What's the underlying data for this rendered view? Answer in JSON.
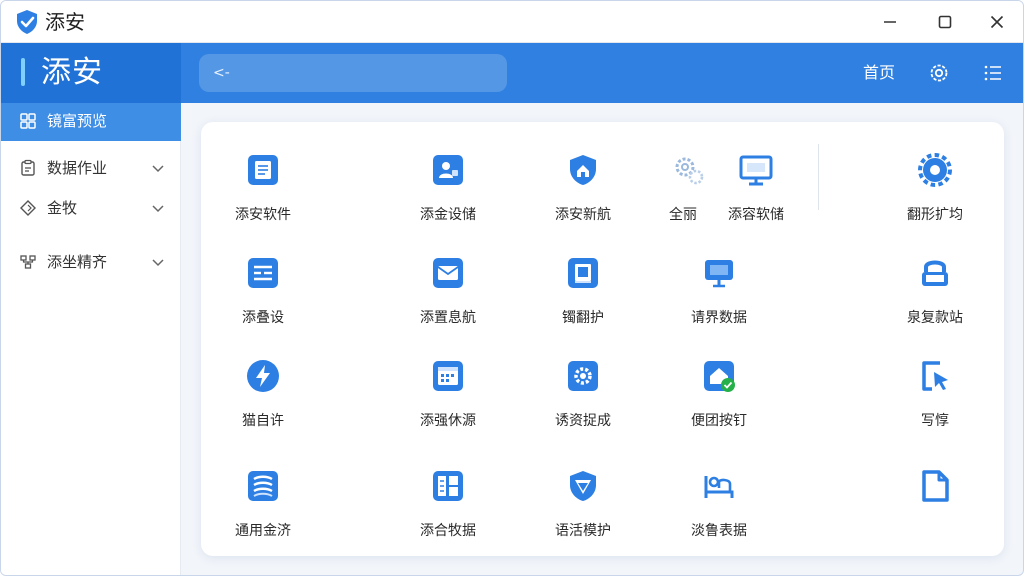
{
  "window": {
    "title": "添安"
  },
  "header": {
    "brand": "添安",
    "search_back": "<-",
    "home_label": "首页"
  },
  "sidebar": {
    "items": [
      {
        "label": "镜富预览",
        "icon": "grid-icon"
      },
      {
        "label": "数据作业",
        "icon": "clipboard-icon"
      },
      {
        "label": "金牧",
        "icon": "diamond-icon"
      },
      {
        "label": "添坐精齐",
        "icon": "structure-icon"
      }
    ]
  },
  "tiles": [
    {
      "label": "添安软件",
      "icon": "document-icon"
    },
    {
      "label": "添金设储",
      "icon": "user-card-icon"
    },
    {
      "label": "添安新航",
      "icon": "shield-home-icon"
    },
    {
      "label": "全丽",
      "icon": "gears-icon"
    },
    {
      "label": "添容软储",
      "icon": "monitor-icon"
    },
    {
      "label": "翻形扩均",
      "icon": "gear-icon"
    },
    {
      "label": "添叠设",
      "icon": "list-icon"
    },
    {
      "label": "添置息航",
      "icon": "mail-icon"
    },
    {
      "label": "镯翻护",
      "icon": "book-icon"
    },
    {
      "label": "请界数据",
      "icon": "display-icon"
    },
    {
      "label": "泉复款站",
      "icon": "lock-icon"
    },
    {
      "label": "猫自许",
      "icon": "lightning-icon"
    },
    {
      "label": "添强休源",
      "icon": "calendar-icon"
    },
    {
      "label": "诱资捉成",
      "icon": "settings-icon"
    },
    {
      "label": "便团按钉",
      "icon": "home-check-icon"
    },
    {
      "label": "写惇",
      "icon": "cursor-icon"
    },
    {
      "label": "通用金济",
      "icon": "database-icon"
    },
    {
      "label": "添合牧据",
      "icon": "table-icon"
    },
    {
      "label": "语活模护",
      "icon": "shield-down-icon"
    },
    {
      "label": "淡鲁表据",
      "icon": "person-bed-icon"
    },
    {
      "label": "",
      "icon": "file-icon"
    }
  ],
  "colors": {
    "accent": "#2f80e0",
    "brand_dark": "#2172d6",
    "icon_blue": "#2d7fe3"
  }
}
